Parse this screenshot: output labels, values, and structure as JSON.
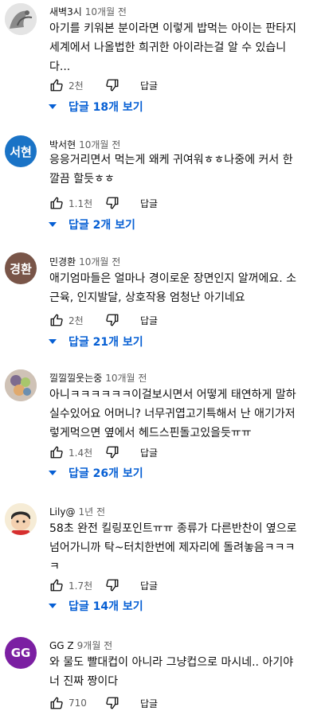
{
  "labels": {
    "reply": "답글"
  },
  "colors": {
    "link": "#065fd4",
    "meta": "#606060"
  },
  "comments": [
    {
      "author": "새벽3시",
      "time": "10개월 전",
      "avatar_text": "",
      "avatar_color": "#d9d9d9",
      "text": "아기를 키워본 분이라면 이렇게 밥먹는 아이는 판타지\n세계에서 나올법한 희귀한 아이라는걸 알 수 있습니\n다...",
      "likes": "2천",
      "replies": "답글 18개 보기"
    },
    {
      "author": "박서현",
      "time": "10개월 전",
      "avatar_text": "서현",
      "avatar_color": "#1a73c6",
      "text": "응응거리면서 먹는게 왜케 귀여워ㅎㅎ나중에 커서 한\n깔끔 할듯ㅎㅎ",
      "likes": "1.1천",
      "replies": "답글 2개 보기"
    },
    {
      "author": "민경환",
      "time": "10개월 전",
      "avatar_text": "경환",
      "avatar_color": "#795548",
      "text": "애기엄마들은 얼마나 경이로운 장면인지 알꺼에요. 소\n근육, 인지발달, 상호작용 엄청난 아기네요",
      "likes": "2천",
      "replies": "답글 21개 보기"
    },
    {
      "author": "낄낄낄웃는중",
      "time": "10개월 전",
      "avatar_text": "",
      "avatar_color": "#c9b6a8",
      "text": "아니ㅋㅋㅋㅋㅋㅋ이걸보시면서 어떻게 태연하게 말하\n실수있어요 어머니? 너무귀엽고기특해서 난 애기가저\n렇게먹으면 옆에서 헤드스핀돌고있을듯ㅠㅠ",
      "likes": "1.4천",
      "replies": "답글 26개 보기"
    },
    {
      "author": "Lily@",
      "time": "1년 전",
      "avatar_text": "",
      "avatar_color": "#f2e6c9",
      "text": "58초 완전 킬링포인트ㅠㅠ 종류가 다른반찬이 옆으로\n넘어가니까 탁~터치한번에 제자리에 돌려놓음ㅋㅋㅋ\nㅋ",
      "likes": "1.7천",
      "replies": "답글 14개 보기"
    },
    {
      "author": "GG Z",
      "time": "9개월 전",
      "avatar_text": "GG",
      "avatar_color": "#7b1fa2",
      "text": "와 물도 빨대컵이 아니라 그냥컵으로 마시네.. 아기야\n너 진짜 짱이다",
      "likes": "710",
      "replies": ""
    }
  ]
}
